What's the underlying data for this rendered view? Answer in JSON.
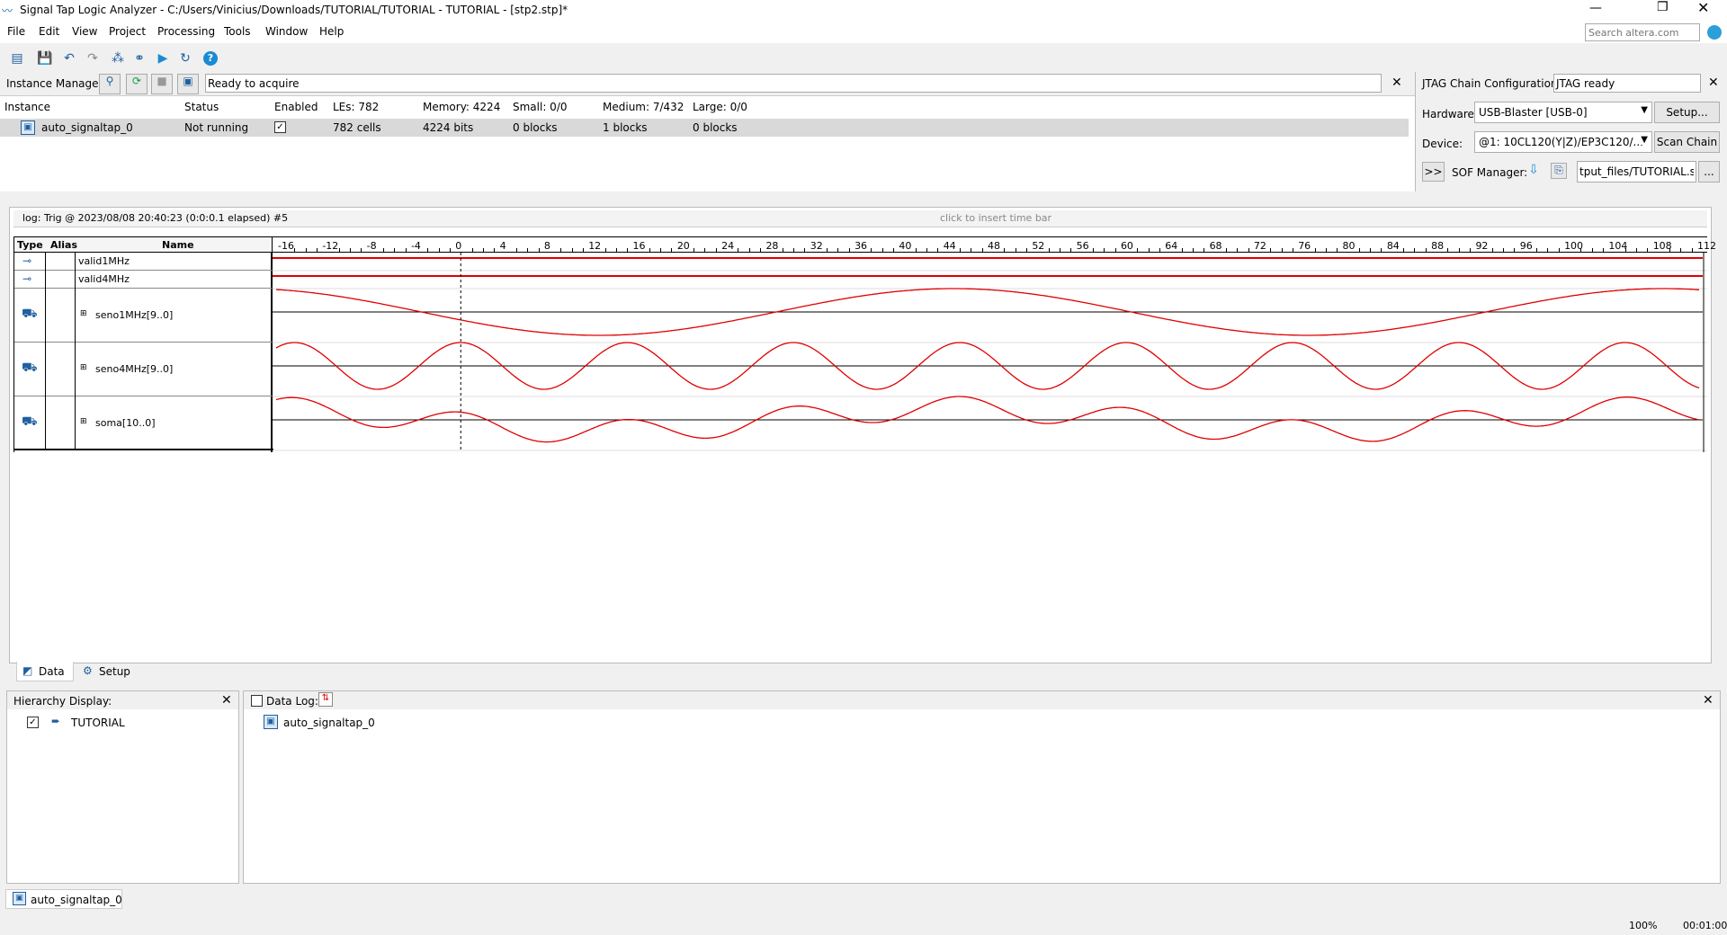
{
  "window": {
    "title": "Signal Tap Logic Analyzer - C:/Users/Vinicius/Downloads/TUTORIAL/TUTORIAL - TUTORIAL - [stp2.stp]*",
    "search_placeholder": "Search altera.com"
  },
  "menu": [
    "File",
    "Edit",
    "View",
    "Project",
    "Processing",
    "Tools",
    "Window",
    "Help"
  ],
  "instance_manager": {
    "label": "Instance Manager:",
    "status": "Ready to acquire",
    "columns": [
      "Instance",
      "Status",
      "Enabled",
      "LEs: 782",
      "Memory: 4224",
      "Small: 0/0",
      "Medium: 7/432",
      "Large: 0/0"
    ],
    "rows": [
      {
        "instance": "auto_signaltap_0",
        "status": "Not running",
        "enabled": "✓",
        "les": "782 cells",
        "memory": "4224 bits",
        "small": "0 blocks",
        "medium": "1 blocks",
        "large": "0 blocks"
      }
    ]
  },
  "jtag": {
    "label": "JTAG Chain Configuration:",
    "status": "JTAG ready",
    "hardware_label": "Hardware:",
    "hardware_value": "USB-Blaster [USB-0]",
    "setup_button": "Setup...",
    "device_label": "Device:",
    "device_value": "@1: 10CL120(Y|Z)/EP3C120/...",
    "scan_button": "Scan Chain",
    "expand_button": ">>",
    "sof_label": "SOF Manager:",
    "sof_value": "tput_files/TUTORIAL.sof",
    "browse_button": "..."
  },
  "waveform": {
    "log_title": "log: Trig @ 2023/08/08 20:40:23 (0:0:0.1 elapsed) #5",
    "insert_hint": "click to insert time bar",
    "col_type": "Type",
    "col_alias": "Alias",
    "col_name": "Name",
    "ticks": [
      "-16",
      "-12",
      "-8",
      "-4",
      "0",
      "4",
      "8",
      "12",
      "16",
      "20",
      "24",
      "28",
      "32",
      "36",
      "40",
      "44",
      "48",
      "52",
      "56",
      "60",
      "64",
      "68",
      "72",
      "76",
      "80",
      "84",
      "88",
      "92",
      "96",
      "100",
      "104",
      "108",
      "112"
    ],
    "signals": [
      {
        "name": "valid1MHz",
        "kind": "bit",
        "value": 1
      },
      {
        "name": "valid4MHz",
        "kind": "bit",
        "value": 1
      },
      {
        "name": "seno1MHz[9..0]",
        "kind": "bus",
        "period_samples": 64,
        "phase_deg": 200
      },
      {
        "name": "seno4MHz[9..0]",
        "kind": "bus",
        "period_samples": 15,
        "phase_deg": 90
      },
      {
        "name": "soma[10..0]",
        "kind": "bus",
        "period_samples": 0
      }
    ],
    "colors": {
      "trace": "#e00000",
      "baseline": "#000000",
      "trigger": "#000000"
    }
  },
  "tabs": [
    "Data",
    "Setup"
  ],
  "hierarchy": {
    "label": "Hierarchy Display:",
    "items": [
      "TUTORIAL"
    ]
  },
  "datalog": {
    "label": "Data Log:",
    "items": [
      "auto_signaltap_0"
    ]
  },
  "bottom_tab": "auto_signaltap_0",
  "status": {
    "zoom": "100%",
    "time": "00:01:00"
  }
}
